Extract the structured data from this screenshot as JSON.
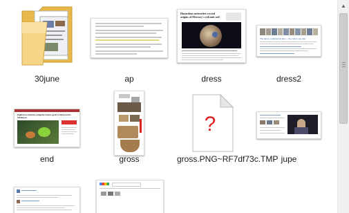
{
  "files": [
    {
      "name": "30june",
      "kind": "folder-icon"
    },
    {
      "name": "ap",
      "kind": "document-thumbnail"
    },
    {
      "name": "dress",
      "kind": "webpage-thumbnail"
    },
    {
      "name": "dress2",
      "kind": "webpage-thumbnail"
    },
    {
      "name": "end",
      "kind": "webpage-thumbnail"
    },
    {
      "name": "gross",
      "kind": "image-thumbnail"
    },
    {
      "name": "gross.PNG~RF7df73c.TMP",
      "kind": "generic-file-icon"
    },
    {
      "name": "jupe",
      "kind": "webpage-thumbnail"
    },
    {
      "name": "",
      "kind": "webpage-thumbnail"
    },
    {
      "name": "",
      "kind": "webpage-thumbnail"
    }
  ],
  "thumbnails": {
    "dress_headline": "Hazardous meteorites crystal origins of Mercury's volcanic soil",
    "end_headline": "Eight bee enemies emigrate leaves grub of bird and its hawkeyes",
    "dress2_headline": "The dress, explained at last — the colors you saw",
    "tmp_mark": "?"
  },
  "colors": {
    "accent_red": "#e02020",
    "folder_yellow": "#f2d27a",
    "link_blue": "#2b58b8"
  }
}
